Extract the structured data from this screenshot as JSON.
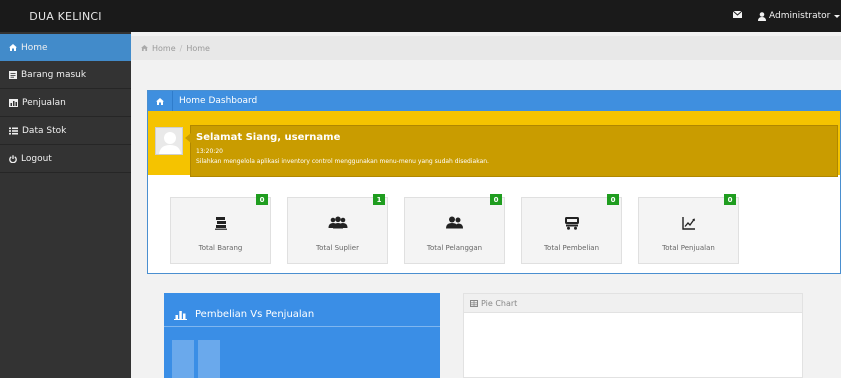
{
  "app": {
    "brand": "DUA KELINCI"
  },
  "topbar": {
    "mail_icon": "envelope-icon",
    "user_label": "Administrator"
  },
  "sidebar": {
    "items": [
      {
        "label": "Home",
        "icon": "home-icon",
        "active": true
      },
      {
        "label": "Barang masuk",
        "icon": "book-icon",
        "active": false
      },
      {
        "label": "Penjualan",
        "icon": "bar-chart-icon",
        "active": false
      },
      {
        "label": "Data Stok",
        "icon": "list-icon",
        "active": false
      },
      {
        "label": "Logout",
        "icon": "power-icon",
        "active": false
      }
    ]
  },
  "breadcrumb": {
    "items": [
      "Home",
      "Home"
    ]
  },
  "dashboard": {
    "title": "Home Dashboard",
    "greeting": "Selamat Siang, username",
    "time": "13:20:20",
    "message": "Silahkan mengelola aplikasi inventory control menggunakan menu-menu yang sudah disediakan.",
    "stats": [
      {
        "label": "Total Barang",
        "count": "0",
        "icon": "books-icon"
      },
      {
        "label": "Total Suplier",
        "count": "1",
        "icon": "group-icon"
      },
      {
        "label": "Total Pelanggan",
        "count": "0",
        "icon": "users-icon"
      },
      {
        "label": "Total Pembelian",
        "count": "0",
        "icon": "cart-icon"
      },
      {
        "label": "Total Penjualan",
        "count": "0",
        "icon": "line-chart-icon"
      }
    ]
  },
  "widgets": {
    "chart_title": "Pembelian Vs Penjualan",
    "pie_title": "Pie Chart"
  },
  "colors": {
    "accent": "#428bca",
    "dashboard_header": "#3f8fdf",
    "welcome_band": "#f5c300",
    "welcome_bubble": "#c99c00",
    "badge": "#1f9d1f",
    "navbar": "#1a1a1a",
    "sidebar": "#333333"
  }
}
